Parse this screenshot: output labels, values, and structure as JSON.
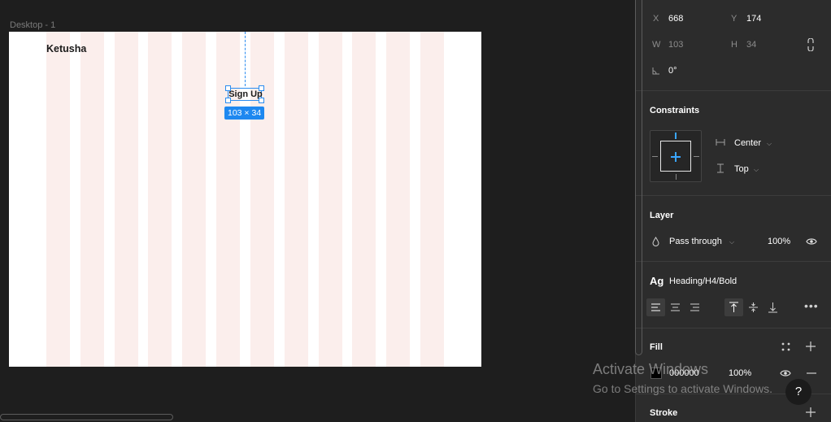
{
  "canvas": {
    "frame_label": "Desktop - 1",
    "brand": "Ketusha",
    "selected_button_text": "Sign Up",
    "dimension_badge": "103 × 34"
  },
  "position": {
    "x_label": "X",
    "x_value": "668",
    "y_label": "Y",
    "y_value": "174",
    "w_label": "W",
    "w_value": "103",
    "h_label": "H",
    "h_value": "34",
    "rotation_value": "0°"
  },
  "constraints": {
    "title": "Constraints",
    "horizontal": "Center",
    "vertical": "Top"
  },
  "layer": {
    "title": "Layer",
    "blend_mode": "Pass through",
    "opacity": "100%"
  },
  "text": {
    "ag_label": "Ag",
    "style_name": "Heading/H4/Bold"
  },
  "fill": {
    "title": "Fill",
    "hex": "000000",
    "opacity": "100%",
    "color": "#000000"
  },
  "stroke": {
    "title": "Stroke"
  },
  "overlay": {
    "activate_title": "Activate Windows",
    "activate_sub": "Go to Settings to activate Windows.",
    "help": "?"
  },
  "colors": {
    "accent": "#1e88f0",
    "canvas_bg": "#1e1e1e",
    "panel_bg": "#2c2c2c",
    "grid_column": "#fbeeec"
  }
}
